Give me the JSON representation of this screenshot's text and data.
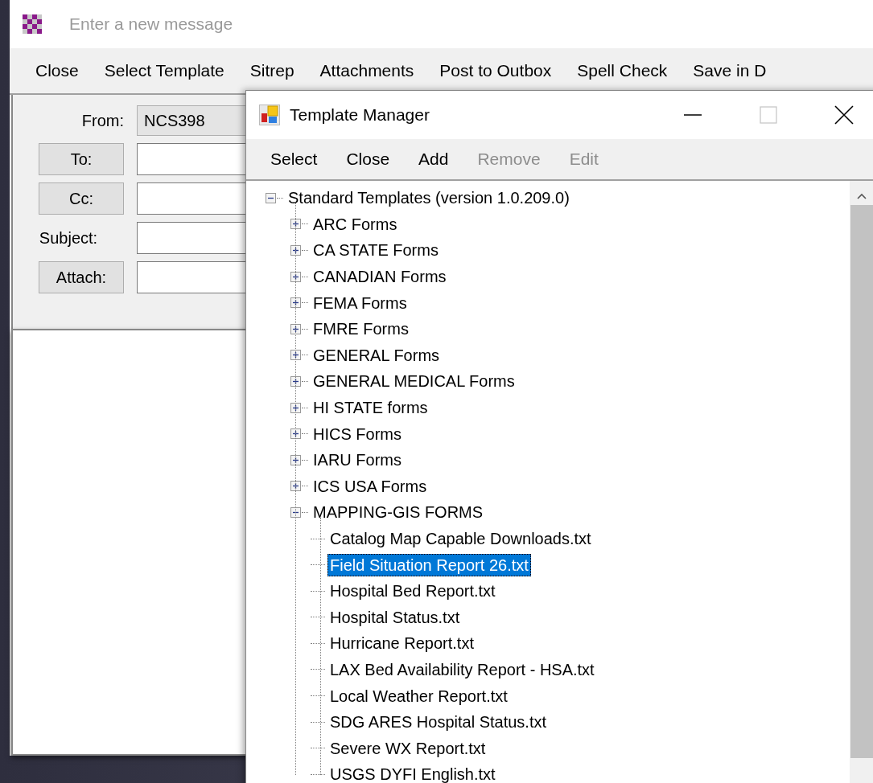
{
  "main_window": {
    "title": "Enter a new message",
    "menu": [
      {
        "label": "Close"
      },
      {
        "label": "Select Template"
      },
      {
        "label": "Sitrep"
      },
      {
        "label": "Attachments"
      },
      {
        "label": "Post to Outbox"
      },
      {
        "label": "Spell Check"
      },
      {
        "label": "Save in D"
      }
    ],
    "form": {
      "from_label": "From:",
      "from_value": "NCS398",
      "fields": [
        {
          "kind": "button",
          "label": "To:"
        },
        {
          "kind": "button",
          "label": "Cc:"
        },
        {
          "kind": "label",
          "label": "Subject:"
        },
        {
          "kind": "button",
          "label": "Attach:"
        }
      ]
    }
  },
  "template_manager": {
    "title": "Template Manager",
    "toolbar": [
      {
        "label": "Select",
        "disabled": false
      },
      {
        "label": "Close",
        "disabled": false
      },
      {
        "label": "Add",
        "disabled": false
      },
      {
        "label": "Remove",
        "disabled": true
      },
      {
        "label": "Edit",
        "disabled": true
      }
    ],
    "tree": {
      "label": "Standard Templates (version 1.0.209.0)",
      "kind": "folder",
      "expanded": true,
      "selected": false,
      "children": [
        {
          "label": "ARC Forms",
          "kind": "folder",
          "expanded": false,
          "selected": false
        },
        {
          "label": "CA STATE Forms",
          "kind": "folder",
          "expanded": false,
          "selected": false
        },
        {
          "label": "CANADIAN Forms",
          "kind": "folder",
          "expanded": false,
          "selected": false
        },
        {
          "label": "FEMA Forms",
          "kind": "folder",
          "expanded": false,
          "selected": false
        },
        {
          "label": "FMRE Forms",
          "kind": "folder",
          "expanded": false,
          "selected": false
        },
        {
          "label": "GENERAL Forms",
          "kind": "folder",
          "expanded": false,
          "selected": false
        },
        {
          "label": "GENERAL MEDICAL Forms",
          "kind": "folder",
          "expanded": false,
          "selected": false
        },
        {
          "label": "HI STATE forms",
          "kind": "folder",
          "expanded": false,
          "selected": false
        },
        {
          "label": "HICS Forms",
          "kind": "folder",
          "expanded": false,
          "selected": false
        },
        {
          "label": "IARU Forms",
          "kind": "folder",
          "expanded": false,
          "selected": false
        },
        {
          "label": "ICS USA Forms",
          "kind": "folder",
          "expanded": false,
          "selected": false
        },
        {
          "label": "MAPPING-GIS FORMS",
          "kind": "folder",
          "expanded": true,
          "selected": false,
          "children": [
            {
              "label": "Catalog Map Capable Downloads.txt",
              "kind": "file",
              "selected": false
            },
            {
              "label": "Field Situation Report 26.txt",
              "kind": "file",
              "selected": true
            },
            {
              "label": "Hospital Bed Report.txt",
              "kind": "file",
              "selected": false
            },
            {
              "label": "Hospital Status.txt",
              "kind": "file",
              "selected": false
            },
            {
              "label": "Hurricane Report.txt",
              "kind": "file",
              "selected": false
            },
            {
              "label": "LAX Bed Availability Report - HSA.txt",
              "kind": "file",
              "selected": false
            },
            {
              "label": "Local Weather Report.txt",
              "kind": "file",
              "selected": false
            },
            {
              "label": "SDG ARES Hospital Status.txt",
              "kind": "file",
              "selected": false
            },
            {
              "label": "Severe WX Report.txt",
              "kind": "file",
              "selected": false
            },
            {
              "label": "USGS DYFI English.txt",
              "kind": "file",
              "selected": false
            }
          ]
        }
      ]
    }
  }
}
